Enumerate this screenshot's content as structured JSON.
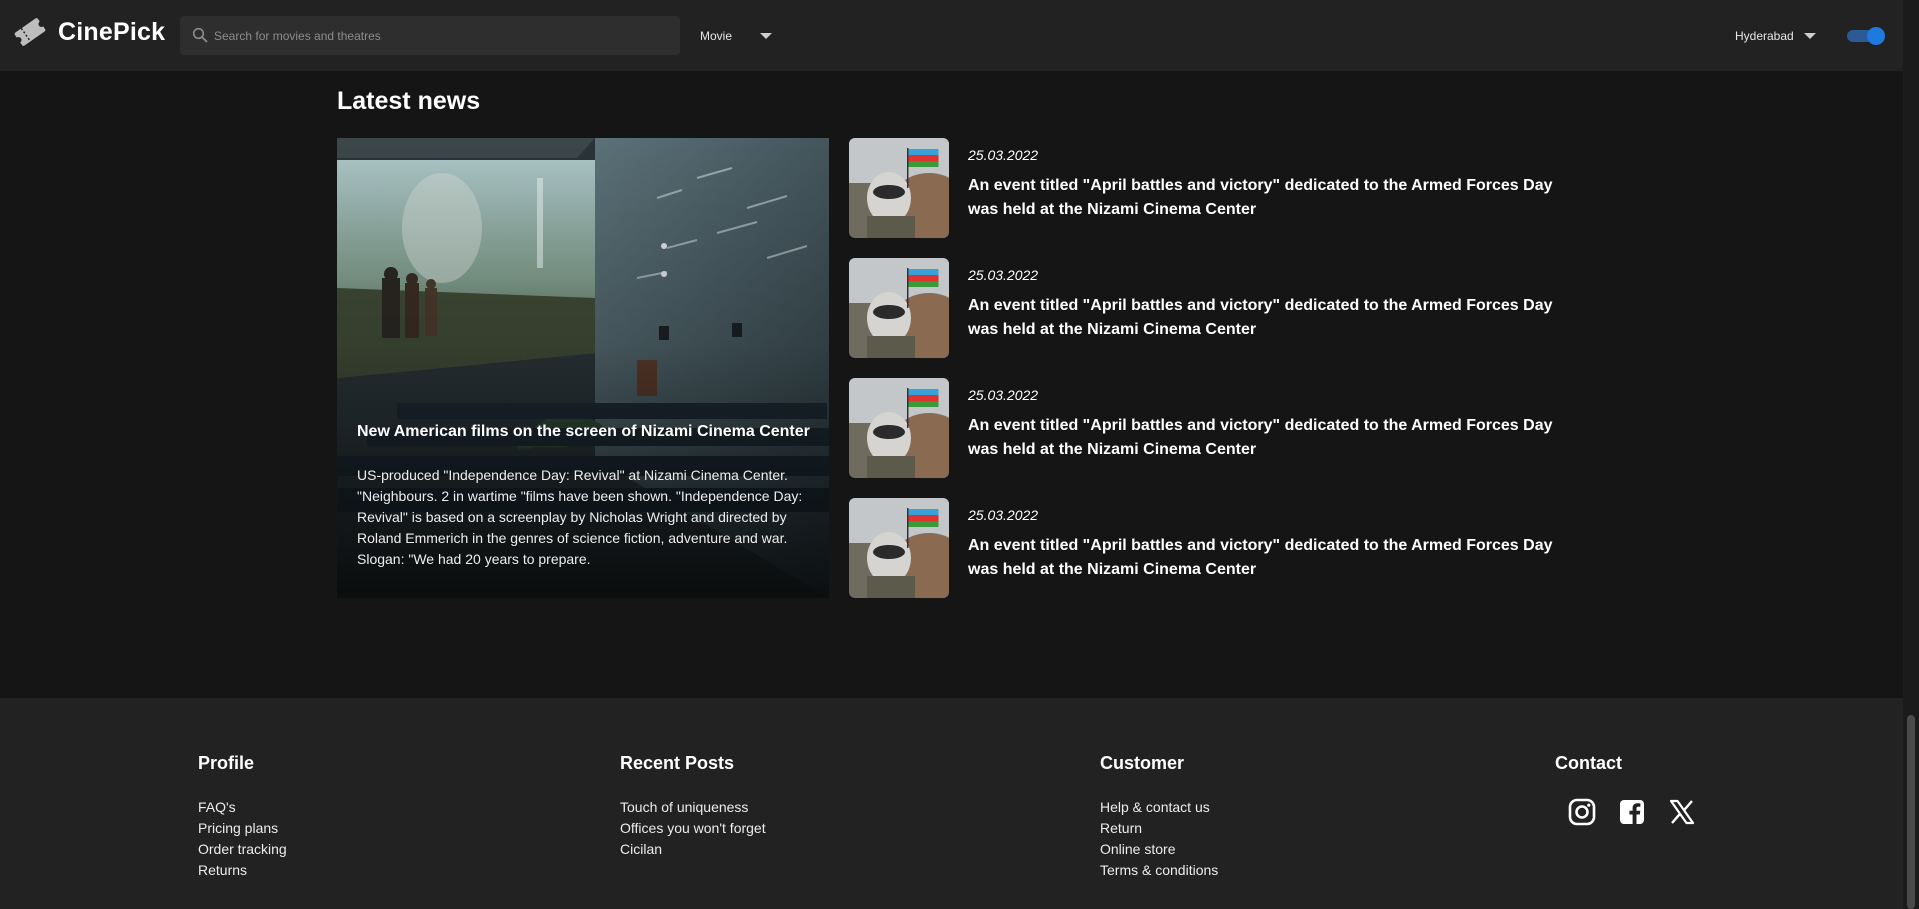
{
  "header": {
    "logo_text": "CinePick",
    "search_placeholder": "Search for movies and theatres",
    "category_selected": "Movie",
    "city_selected": "Hyderabad",
    "toggle_on": true,
    "accent_color": "#1f7ae0"
  },
  "news": {
    "section_title": "Latest news",
    "featured": {
      "title": "New American films on the screen of Nizami Cinema Center",
      "body": "US-produced \"Independence Day: Revival\" at Nizami Cinema Center. \"Neighbours. 2 in wartime \"films have been shown. \"Independence Day: Revival\" is based on a screenplay by Nicholas Wright and directed by Roland Emmerich in the genres of science fiction, adventure and war. Slogan: \"We had 20 years to prepare."
    },
    "items": [
      {
        "date": "25.03.2022",
        "title": "An event titled \"April battles and victory\" dedicated to the Armed Forces Day was held at the Nizami Cinema Center"
      },
      {
        "date": "25.03.2022",
        "title": "An event titled \"April battles and victory\" dedicated to the Armed Forces Day was held at the Nizami Cinema Center"
      },
      {
        "date": "25.03.2022",
        "title": "An event titled \"April battles and victory\" dedicated to the Armed Forces Day was held at the Nizami Cinema Center"
      },
      {
        "date": "25.03.2022",
        "title": "An event titled \"April battles and victory\" dedicated to the Armed Forces Day was held at the Nizami Cinema Center"
      }
    ]
  },
  "footer": {
    "profile": {
      "heading": "Profile",
      "links": [
        "FAQ's",
        "Pricing plans",
        "Order tracking",
        "Returns"
      ]
    },
    "recent_posts": {
      "heading": "Recent Posts",
      "links": [
        "Touch of uniqueness",
        "Offices you won't forget",
        "Cicilan"
      ]
    },
    "customer": {
      "heading": "Customer",
      "links": [
        "Help & contact us",
        "Return",
        "Online store",
        "Terms & conditions"
      ]
    },
    "contact": {
      "heading": "Contact",
      "icons": [
        "instagram-icon",
        "facebook-icon",
        "x-icon"
      ]
    }
  }
}
